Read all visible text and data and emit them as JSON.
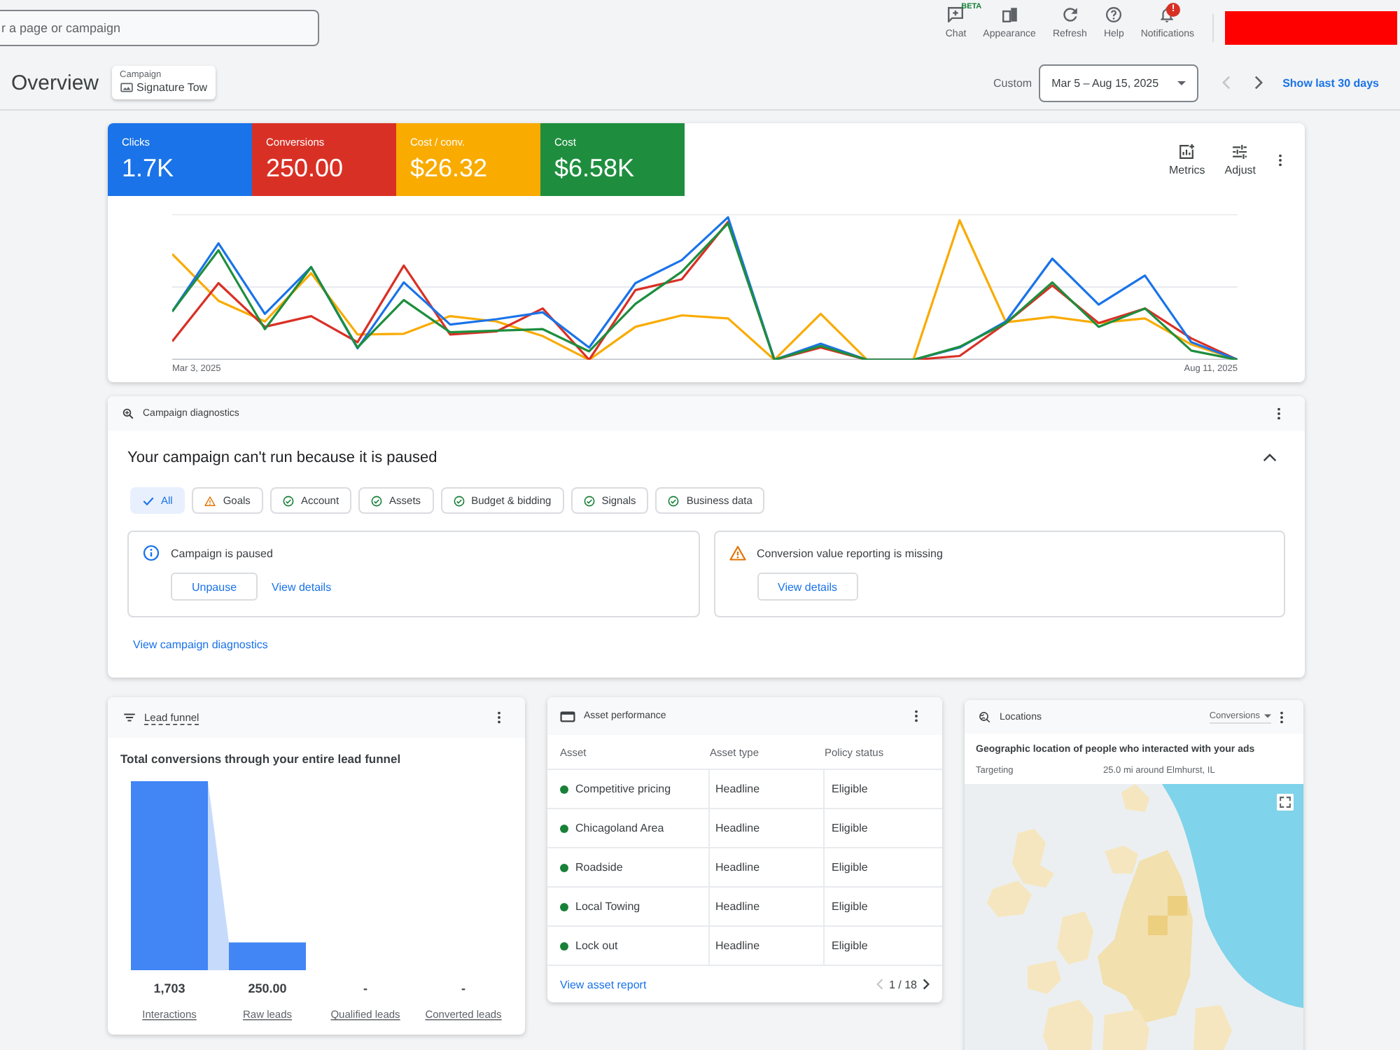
{
  "top_bar": {
    "search": {
      "placeholder": "r a page or campaign"
    },
    "tools": [
      {
        "kind": "chat",
        "label": "Chat",
        "badge": {
          "kind": "label",
          "text": "BETA"
        }
      },
      {
        "kind": "appearance",
        "label": "Appearance"
      },
      {
        "kind": "refresh",
        "label": "Refresh"
      },
      {
        "kind": "help",
        "label": "Help"
      },
      {
        "kind": "notifications",
        "label": "Notifications",
        "badge": {
          "kind": "count",
          "text": "!"
        }
      }
    ]
  },
  "header": {
    "title": "Overview",
    "campaign": {
      "label": "Campaign",
      "value": "Signature Tow"
    },
    "date_label": "Custom",
    "date_range": "Mar 5 – Aug 15, 2025",
    "prev": {
      "disabled": true
    },
    "next": {
      "disabled": false
    },
    "link": "Show last 30 days"
  },
  "performance": {
    "metrics": [
      {
        "label": "Clicks",
        "value": "1.7K",
        "color": "#1a73e8",
        "selected": true
      },
      {
        "label": "Conversions",
        "value": "250.00",
        "color": "#d93025",
        "selected": true
      },
      {
        "label": "Cost / conv.",
        "value": "$26.32",
        "color": "#f9ab00",
        "selected": true
      },
      {
        "label": "Cost",
        "value": "$6.58K",
        "color": "#1e8e3e",
        "selected": true
      }
    ],
    "actions": [
      {
        "kind": "metrics",
        "label": "Metrics"
      },
      {
        "kind": "adjust",
        "label": "Adjust"
      }
    ],
    "chart": {
      "x_labels": [
        "Mar 3, 2025",
        "Aug 11, 2025"
      ]
    }
  },
  "diagnostics": {
    "title": "Campaign diagnostics",
    "headline": "Your campaign can't run because it is paused",
    "expanded": true,
    "filters": [
      {
        "label": "All",
        "kind": "all",
        "selected": true
      },
      {
        "label": "Goals",
        "kind": "warning",
        "selected": false
      },
      {
        "label": "Account",
        "kind": "ok",
        "selected": false
      },
      {
        "label": "Assets",
        "kind": "ok",
        "selected": false
      },
      {
        "label": "Budget & bidding",
        "kind": "ok",
        "selected": false
      },
      {
        "label": "Signals",
        "kind": "ok",
        "selected": false
      },
      {
        "label": "Business data",
        "kind": "ok",
        "selected": false
      }
    ],
    "issues": [
      {
        "kind": "info",
        "title": "Campaign is paused",
        "buttons": [
          {
            "kind": "outlined",
            "label": "Unpause"
          },
          {
            "kind": "link",
            "label": "View details"
          }
        ]
      },
      {
        "kind": "warning",
        "title": "Conversion value reporting is missing",
        "buttons": [
          {
            "kind": "outlined",
            "label": "View details"
          }
        ]
      }
    ],
    "link": "View campaign diagnostics"
  },
  "lead_funnel": {
    "title": "Lead funnel",
    "subtitle": "Total conversions through your entire lead funnel",
    "chart_data": [
      {
        "type": "bar",
        "categories": [
          "Interactions",
          "Raw leads",
          "Qualified leads",
          "Converted leads"
        ],
        "values": [
          1703,
          250,
          null,
          null
        ],
        "color": "#4285f4",
        "data_labels": true,
        "value_labels": [
          "1,703",
          "250.00",
          "-",
          "-"
        ]
      }
    ]
  },
  "assets": {
    "title": "Asset performance",
    "columns": [
      "Asset",
      "Asset type",
      "Policy status"
    ],
    "rows": [
      {
        "asset": "Competitive pricing",
        "type": "Headline",
        "status": "Eligible",
        "color": "#188038"
      },
      {
        "asset": "Chicagoland Area",
        "type": "Headline",
        "status": "Eligible",
        "color": "#188038"
      },
      {
        "asset": "Roadside",
        "type": "Headline",
        "status": "Eligible",
        "color": "#188038"
      },
      {
        "asset": "Local Towing",
        "type": "Headline",
        "status": "Eligible",
        "color": "#188038"
      },
      {
        "asset": "Lock out",
        "type": "Headline",
        "status": "Eligible",
        "color": "#188038"
      }
    ],
    "link": "View asset report",
    "pager": {
      "text": "1 / 18",
      "prev": {
        "disabled": true
      },
      "next": {
        "disabled": false
      }
    }
  },
  "locations": {
    "title": "Locations",
    "metric": "Conversions",
    "subtitle": "Geographic location of people who interacted with your ads",
    "targeting": {
      "label": "Targeting",
      "value": "25.0 mi around Elmhurst, IL"
    }
  }
}
